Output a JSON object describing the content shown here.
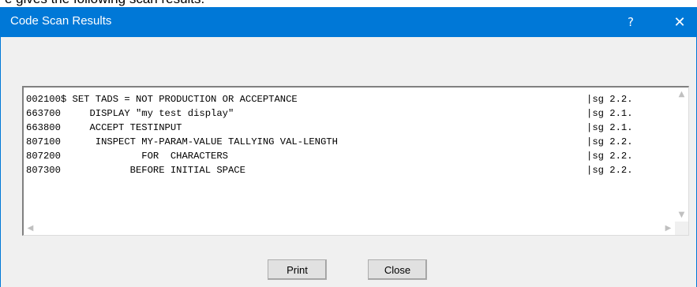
{
  "caption": "e gives the following scan results.",
  "window": {
    "title": "Code Scan Results",
    "help_glyph": "?",
    "close_glyph": "✕"
  },
  "code": {
    "lines": [
      {
        "text": "002100$ SET TADS = NOT PRODUCTION OR ACCEPTANCE",
        "tag": "|sg 2.2."
      },
      {
        "text": "663700     DISPLAY \"my test display\"",
        "tag": "|sg 2.1."
      },
      {
        "text": "663800     ACCEPT TESTINPUT",
        "tag": "|sg 2.1."
      },
      {
        "text": "807100      INSPECT MY-PARAM-VALUE TALLYING VAL-LENGTH",
        "tag": "|sg 2.2."
      },
      {
        "text": "807200              FOR  CHARACTERS",
        "tag": "|sg 2.2."
      },
      {
        "text": "807300            BEFORE INITIAL SPACE",
        "tag": "|sg 2.2."
      }
    ]
  },
  "scrollbars": {
    "up": "▲",
    "down": "▼",
    "left": "◀",
    "right": "▶"
  },
  "buttons": {
    "print": "Print",
    "close": "Close"
  }
}
